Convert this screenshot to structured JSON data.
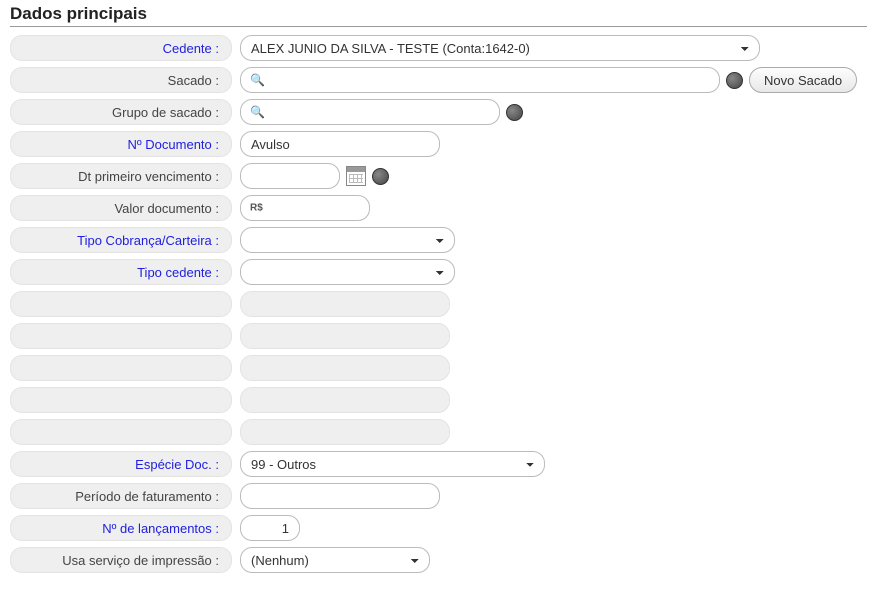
{
  "section": {
    "title": "Dados principais"
  },
  "labels": {
    "cedente": "Cedente :",
    "sacado": "Sacado :",
    "grupo_sacado": "Grupo de sacado :",
    "n_documento": "Nº Documento :",
    "dt_primeiro_venc": "Dt primeiro vencimento :",
    "valor_documento": "Valor documento :",
    "tipo_cobranca": "Tipo Cobrança/Carteira :",
    "tipo_cedente": "Tipo cedente :",
    "especie_doc": "Espécie Doc. :",
    "periodo_faturamento": "Período de faturamento :",
    "n_lancamentos": "Nº de lançamentos :",
    "usa_impressao": "Usa serviço de impressão :"
  },
  "fields": {
    "cedente_selected": "ALEX JUNIO DA SILVA - TESTE (Conta:1642-0)",
    "sacado_value": "",
    "grupo_sacado_value": "",
    "n_documento_value": "Avulso",
    "dt_primeiro_venc_value": "",
    "valor_documento_value": "",
    "valor_prefix": "R$",
    "tipo_cobranca_selected": "",
    "tipo_cedente_selected": "",
    "blank1": "",
    "blank2": "",
    "blank3": "",
    "blank4": "",
    "blank5": "",
    "especie_doc_selected": "99 - Outros",
    "periodo_faturamento_value": "",
    "n_lancamentos_value": "1",
    "usa_impressao_selected": "(Nenhum)"
  },
  "buttons": {
    "novo_sacado": "Novo Sacado"
  }
}
